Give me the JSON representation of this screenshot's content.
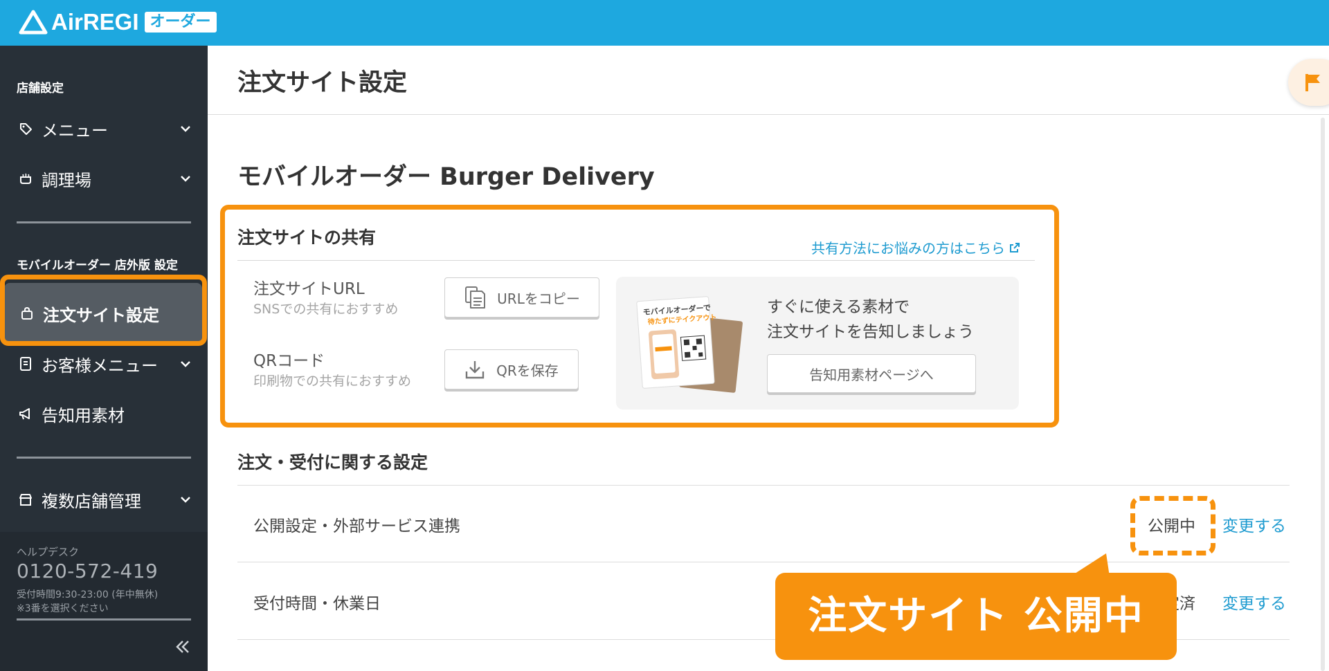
{
  "app": {
    "brand": "AirREGI",
    "badge": "オーダー"
  },
  "sidebar": {
    "section1_heading": "店舗設定",
    "items1": [
      {
        "label": "メニュー",
        "icon": "tag-icon"
      },
      {
        "label": "調理場",
        "icon": "cooking-pot-icon"
      }
    ],
    "section2_heading": "モバイルオーダー 店外版 設定",
    "items2": [
      {
        "label": "注文サイト設定",
        "icon": "shopping-bag-icon",
        "active": true
      },
      {
        "label": "お客様メニュー",
        "icon": "menu-card-icon"
      },
      {
        "label": "告知用素材",
        "icon": "megaphone-icon"
      }
    ],
    "items3": [
      {
        "label": "複数店舗管理",
        "icon": "store-icon"
      }
    ],
    "help": {
      "label": "ヘルプデスク",
      "phone": "0120-572-419",
      "hours": "受付時間9:30-23:00 (年中無休)",
      "note": "※3番を選択ください"
    }
  },
  "header": {
    "title": "注文サイト設定"
  },
  "main": {
    "store_title": "モバイルオーダー Burger Delivery",
    "share": {
      "heading": "注文サイトの共有",
      "help_link": "共有方法にお悩みの方はこちら",
      "url_label": "注文サイトURL",
      "url_sub": "SNSでの共有におすすめ",
      "copy_button": "URLをコピー",
      "qr_label": "QRコード",
      "qr_sub": "印刷物での共有におすすめ",
      "qr_button": "QRを保存",
      "promo_line1": "すぐに使える素材で",
      "promo_line2": "注文サイトを告知しましょう",
      "promo_button": "告知用素材ページへ",
      "promo_card_line1": "モバイルオーダーで",
      "promo_card_line2": "待たずにテイクアウト"
    },
    "settings": {
      "heading": "注文・受付に関する設定",
      "rows": [
        {
          "label": "公開設定・外部サービス連携",
          "status": "公開中",
          "action": "変更する"
        },
        {
          "label": "受付時間・休業日",
          "status": "設定済",
          "action": "変更する"
        }
      ]
    },
    "callout": "注文サイト 公開中"
  },
  "colors": {
    "topbar": "#1ea8df",
    "sidebar": "#283038",
    "accent_orange": "#f7920e",
    "link_blue": "#1e9bd0"
  }
}
